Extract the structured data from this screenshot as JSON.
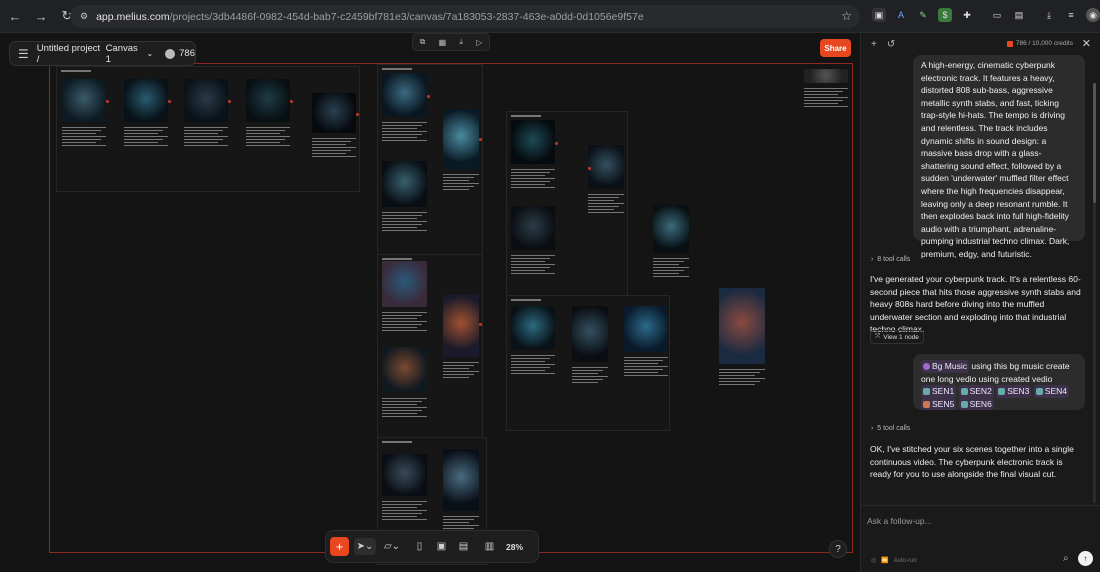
{
  "browser": {
    "url_host": "app.melius.com",
    "url_path": "/projects/3db4486f-0982-454d-bab7-c2459bf781e3/canvas/7a183053-2837-463e-a0dd-0d1056e9f57e"
  },
  "project": {
    "title": "Untitled project /",
    "canvas_name": "Canvas 1",
    "credits": "786"
  },
  "share_label": "Share",
  "zoom_level": "28%",
  "panel": {
    "credits_badge": "786 / 10,000 credits",
    "prompt_text": "A high-energy, cinematic cyberpunk electronic track. It features a heavy, distorted 808 sub-bass, aggressive metallic synth stabs, and fast, ticking trap-style hi-hats. The tempo is driving and relentless. The track includes dynamic shifts in sound design: a massive bass drop with a glass-shattering sound effect, followed by a sudden 'underwater' muffled filter effect where the high frequencies disappear, leaving only a deep resonant rumble. It then explodes back into full high-fidelity audio with a triumphant, adrenaline-pumping industrial techno climax. Dark, premium, edgy, and futuristic.",
    "tool_calls_1": "8 tool calls",
    "reply_1": "I've generated your cyberpunk track. It's a relentless 60-second piece that hits those aggressive synth stabs and heavy 808s hard before diving into the muffled underwater section and exploding into that industrial techno climax.",
    "view_node": "View 1 node",
    "user_msg": {
      "tag_bg": "Bg Music",
      "text": "using this bg music create one long vedio using created vedio",
      "tags": [
        "SEN1",
        "SEN2",
        "SEN3",
        "SEN4",
        "SEN5",
        "SEN6"
      ]
    },
    "tool_calls_2": "5 tool calls",
    "reply_2": "OK, I've stitched your six scenes together into a single continuous video. The cyberpunk electronic track is ready for you to use alongside the final visual cut.",
    "input_placeholder": "Ask a follow-up...",
    "autorun_label": "Auto-run"
  },
  "colors": {
    "accent": "#e8471f",
    "frame_border": "#8a2a22",
    "canvas_bg": "#141414"
  }
}
